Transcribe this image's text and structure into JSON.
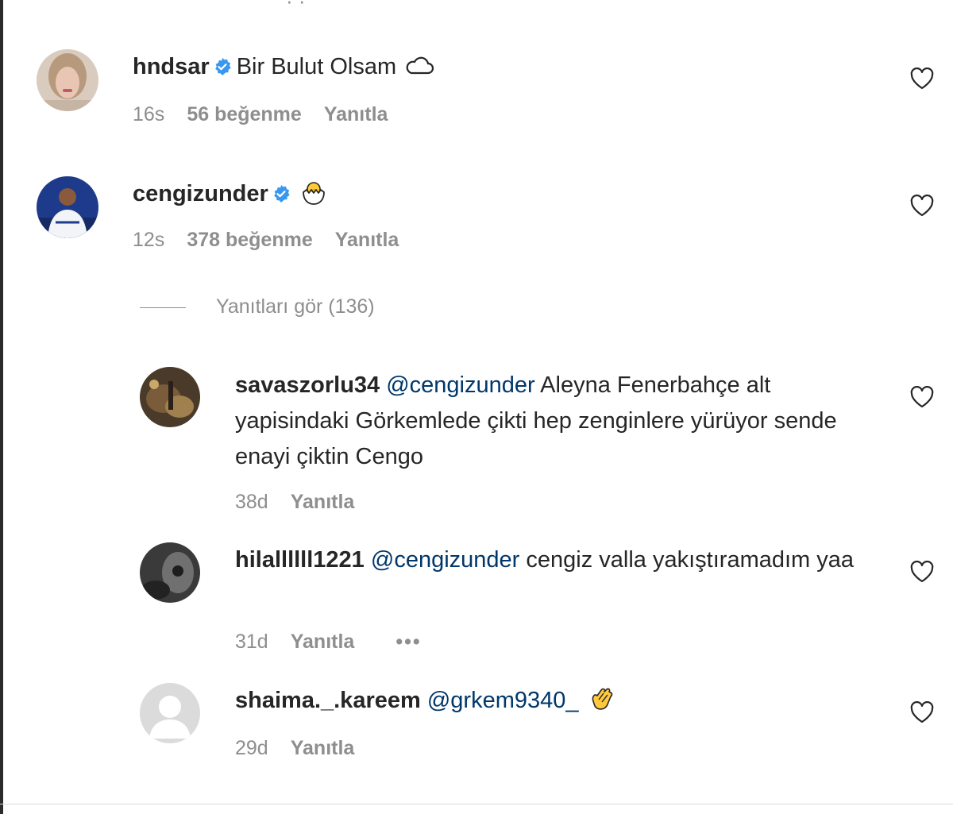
{
  "comments": [
    {
      "username": "hndsar",
      "verified": true,
      "text": "Bir Bulut Olsam",
      "emoji_icon": "cloud-icon",
      "time": "16s",
      "likes": "56 beğenme",
      "reply": "Yanıtla"
    },
    {
      "username": "cengizunder",
      "verified": true,
      "text": "",
      "emoji_icon": "hatching-chick-icon",
      "time": "12s",
      "likes": "378 beğenme",
      "reply": "Yanıtla"
    }
  ],
  "view_replies": "Yanıtları gör (136)",
  "replies": [
    {
      "username": "savaszorlu34",
      "mention": "@cengizunder",
      "text": "Aleyna Fenerbahçe alt yapisindaki Görkemlede çikti hep zenginlere yürüyor sende enayi çiktin Cengo",
      "time": "38d",
      "reply": "Yanıtla"
    },
    {
      "username": "hilallllll1221",
      "mention": "@cengizunder",
      "text": "cengiz valla yakıştıramadım yaa",
      "time": "31d",
      "reply": "Yanıtla",
      "more": "•••"
    },
    {
      "username": "shaima._.kareem",
      "mention": "@grkem9340_",
      "text": "",
      "emoji_icon": "clapping-hands-icon",
      "time": "29d",
      "reply": "Yanıtla"
    }
  ],
  "colors": {
    "mention": "#00376b",
    "verified": "#3897f0",
    "muted": "#8e8e8e",
    "text": "#262626"
  }
}
